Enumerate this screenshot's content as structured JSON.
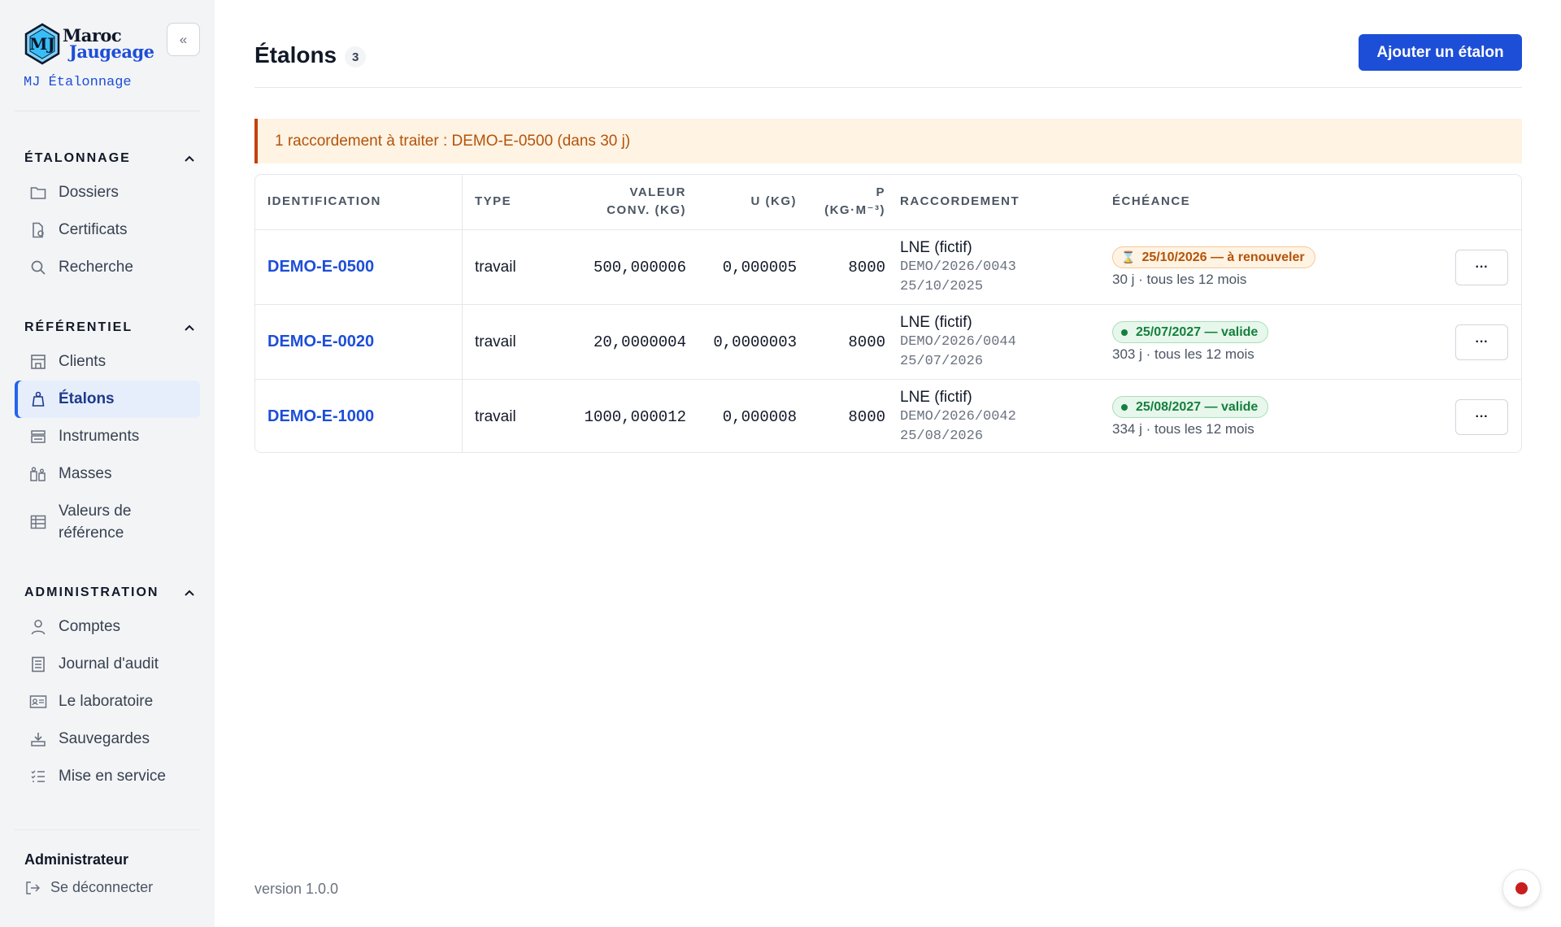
{
  "sidebar": {
    "brand": {
      "line1": "Maroc",
      "line2": "Jaugeage",
      "logo_letters": "MJ"
    },
    "collapse_label": "«",
    "app_subtitle": "MJ Étalonnage",
    "sections": [
      {
        "title": "ÉTALONNAGE",
        "items": [
          {
            "label": "Dossiers",
            "icon": "folder-icon"
          },
          {
            "label": "Certificats",
            "icon": "certificate-icon"
          },
          {
            "label": "Recherche",
            "icon": "search-icon"
          }
        ]
      },
      {
        "title": "RÉFÉRENTIEL",
        "items": [
          {
            "label": "Clients",
            "icon": "building-icon"
          },
          {
            "label": "Étalons",
            "icon": "weight-icon",
            "active": true
          },
          {
            "label": "Instruments",
            "icon": "scale-icon"
          },
          {
            "label": "Masses",
            "icon": "masses-icon"
          },
          {
            "label": "Valeurs de référence",
            "icon": "table-icon"
          }
        ]
      },
      {
        "title": "ADMINISTRATION",
        "items": [
          {
            "label": "Comptes",
            "icon": "user-icon"
          },
          {
            "label": "Journal d'audit",
            "icon": "journal-icon"
          },
          {
            "label": "Le laboratoire",
            "icon": "id-card-icon"
          },
          {
            "label": "Sauvegardes",
            "icon": "download-tray-icon"
          },
          {
            "label": "Mise en service",
            "icon": "checklist-icon"
          }
        ]
      }
    ],
    "user": {
      "name": "Administrateur",
      "logout_label": "Se déconnecter"
    }
  },
  "main": {
    "title": "Étalons",
    "count": "3",
    "add_button": "Ajouter un étalon",
    "alert": "1 raccordement à traiter : DEMO-E-0500 (dans 30 j)",
    "table": {
      "headers": {
        "id": "IDENTIFICATION",
        "type": "TYPE",
        "valeur_1": "VALEUR",
        "valeur_2": "CONV. (KG)",
        "u": "U (KG)",
        "rho_1": "Ρ",
        "rho_2": "(KG·M⁻³)",
        "raccordement": "RACCORDEMENT",
        "echeance": "ÉCHÉANCE"
      },
      "rows": [
        {
          "id": "DEMO-E-0500",
          "type": "travail",
          "valeur": "500,000006",
          "u": "0,000005",
          "rho": "8000",
          "rac_org": "LNE (fictif)",
          "rac_ref": "DEMO/2026/0043",
          "rac_date": "25/10/2025",
          "badge": "25/10/2026 — à renouveler",
          "status": "warn",
          "due_sub": "30 j · tous les 12 mois"
        },
        {
          "id": "DEMO-E-0020",
          "type": "travail",
          "valeur": "20,0000004",
          "u": "0,0000003",
          "rho": "8000",
          "rac_org": "LNE (fictif)",
          "rac_ref": "DEMO/2026/0044",
          "rac_date": "25/07/2026",
          "badge": "25/07/2027 — valide",
          "status": "ok",
          "due_sub": "303 j · tous les 12 mois"
        },
        {
          "id": "DEMO-E-1000",
          "type": "travail",
          "valeur": "1000,000012",
          "u": "0,000008",
          "rho": "8000",
          "rac_org": "LNE (fictif)",
          "rac_ref": "DEMO/2026/0042",
          "rac_date": "25/08/2026",
          "badge": "25/08/2027 — valide",
          "status": "ok",
          "due_sub": "334 j · tous les 12 mois"
        }
      ],
      "more_label": "···"
    },
    "version": "version 1.0.0"
  },
  "colors": {
    "accent": "#1d4ed8",
    "warn": "#b45309",
    "ok": "#15803d",
    "record": "#c81e1e"
  }
}
